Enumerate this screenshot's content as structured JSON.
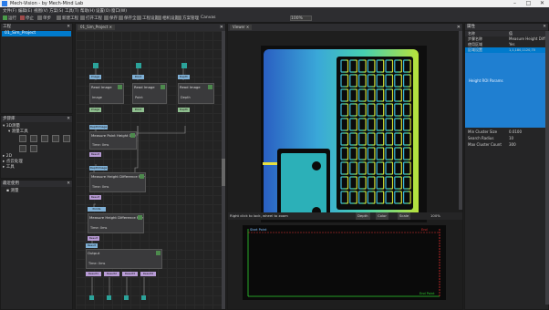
{
  "titlebar": {
    "title": "Mech-Vision - by Mech-Mind Lab",
    "minimize": "–",
    "maximize": "□",
    "close": "✕"
  },
  "menu": [
    "文件(F)",
    "编辑(E)",
    "视图(V)",
    "方案(S)",
    "工具(T)",
    "帮助(H)",
    "设置(O)",
    "窗口(W)"
  ],
  "toolbar": {
    "items": [
      "运行",
      "停止",
      "单步",
      "新建工程",
      "打开工程",
      "保存",
      "保存全部",
      "工程设置",
      "相机设置",
      "方案管理"
    ],
    "extra": "Canvas",
    "zoom": "100%"
  },
  "project_panel": {
    "title": "工程",
    "active_project": "01_Sim_Project"
  },
  "steps_panel": {
    "title": "步骤库",
    "tree": [
      {
        "label": "3D测量",
        "level": 0
      },
      {
        "label": "测量工具",
        "level": 1
      },
      {
        "label": "2D",
        "level": 0
      },
      {
        "label": "点云处理",
        "level": 0
      },
      {
        "label": "工具",
        "level": 0
      }
    ]
  },
  "recent_panel": {
    "title": "最近使用",
    "items": [
      "测量"
    ]
  },
  "graph_tab": {
    "label": "01_Sim_Project"
  },
  "nodes": {
    "n1": {
      "title": "Read Image",
      "in": "Image",
      "label": "Image",
      "out": "Image"
    },
    "n2": {
      "title": "Read Image",
      "in": "Point",
      "label": "Point",
      "out": "Point"
    },
    "n3": {
      "title": "Read Image",
      "in": "Depth",
      "label": "Depth",
      "out": "Depth"
    },
    "n4": {
      "title": "Measure Point Height Difference",
      "in": "DepthImage",
      "label": "Time: 0ms",
      "out": "Result"
    },
    "n5": {
      "title": "Measure Height Difference Points",
      "in": "DepthImage",
      "label": "Time: 0ms",
      "out": "Result"
    },
    "n6": {
      "title": "Measure Height Difference Plane",
      "in": "Points",
      "label": "Time: 0ms",
      "out": "Result"
    },
    "n7": {
      "title": "Output",
      "in": "Result",
      "label": "Time: 0ms",
      "outs": [
        "Result1",
        "Result2",
        "Result3",
        "Result4"
      ]
    }
  },
  "viewer_tab": {
    "label": "Viewer"
  },
  "viewer_status": {
    "hint": "Right click to lock, wheel to zoom",
    "a": "Depth",
    "b": "Color",
    "c": "Scale",
    "zoom": "100%"
  },
  "plot": {
    "label_top_left": "Start Point",
    "label_top_right": "End",
    "label_bottom_right": "End Point"
  },
  "props_panel": {
    "title": "属性",
    "rows": [
      {
        "k": "名称",
        "v": "值"
      },
      {
        "k": "步骤名称",
        "v": "Measure Height Diff"
      },
      {
        "k": "使用区域",
        "v": "Yes"
      },
      {
        "k": "区域设置",
        "v": "1,1,180,1120,70"
      },
      {
        "k": "Height ROI Params",
        "v": ""
      },
      {
        "k": "Min Cluster Size",
        "v": "0.0100"
      },
      {
        "k": "Search Radius",
        "v": "10"
      },
      {
        "k": "Max Cluster Count",
        "v": "300"
      }
    ]
  },
  "colors": {
    "accent": "#2b7de9",
    "selected": "#007acc",
    "plot_red": "#e03030",
    "plot_green": "#30d030"
  }
}
